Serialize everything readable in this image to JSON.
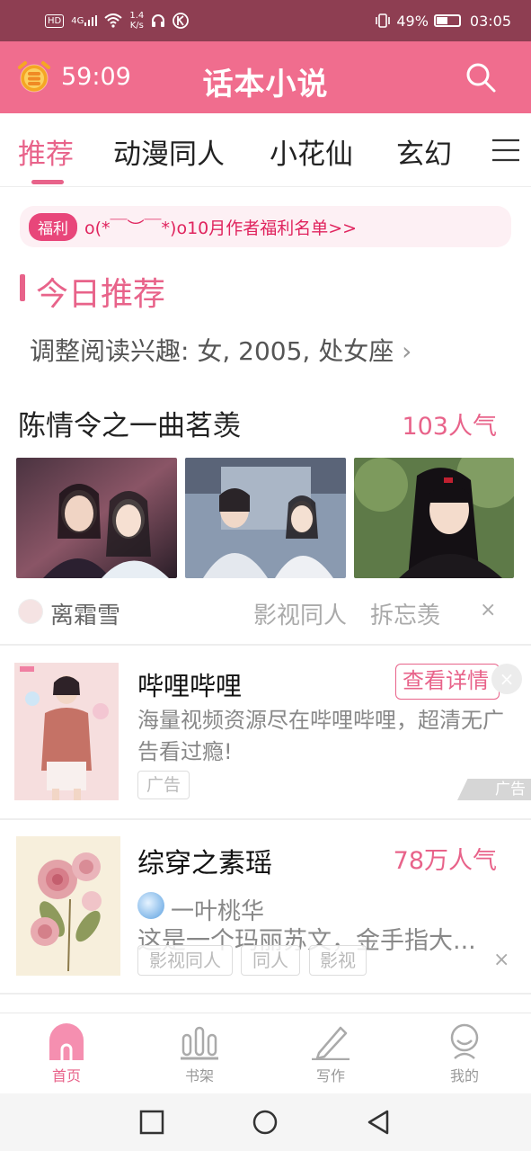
{
  "status_bar": {
    "hd": "HD",
    "signal": "4G",
    "speed_value": "1.4",
    "speed_unit": "K/s",
    "battery": "49%",
    "time": "03:05"
  },
  "header": {
    "timer": "59:09",
    "title": "话本小说"
  },
  "tabs": [
    {
      "label": "推荐",
      "active": true
    },
    {
      "label": "动漫同人"
    },
    {
      "label": "小花仙"
    },
    {
      "label": "玄幻"
    }
  ],
  "notice": {
    "badge": "福利",
    "text": "o(*￣︶￣*)o10月作者福利名单>>"
  },
  "section": {
    "title": "今日推荐",
    "interest": "调整阅读兴趣: 女, 2005, 处女座",
    "interest_arrow": "›"
  },
  "story1": {
    "title": "陈情令之一曲茗羡",
    "popularity": "103人气",
    "author": "离霜雪",
    "tags": [
      "影视同人",
      "拆忘羡"
    ],
    "close": "×"
  },
  "ad": {
    "title": "哔哩哔哩",
    "button": "查看详情",
    "description": "海量视频资源尽在哔哩哔哩，超清无广告看过瘾!",
    "tag": "广告",
    "corner_label": "广告",
    "close": "×"
  },
  "story2": {
    "title": "综穿之素瑶",
    "popularity": "78万人气",
    "author": "一叶桃华",
    "description": "这是一个玛丽苏文，金手指大...",
    "tags": [
      "影视同人",
      "同人",
      "影视"
    ],
    "close": "×"
  },
  "bottom_nav": [
    {
      "label": "首页",
      "icon": "home-icon",
      "active": true
    },
    {
      "label": "书架",
      "icon": "bookshelf-icon"
    },
    {
      "label": "写作",
      "icon": "pen-icon"
    },
    {
      "label": "我的",
      "icon": "profile-icon"
    }
  ],
  "colors": {
    "brand_pink": "#f06d8e",
    "accent": "#e8638a",
    "status_bar": "#8e3e52"
  }
}
